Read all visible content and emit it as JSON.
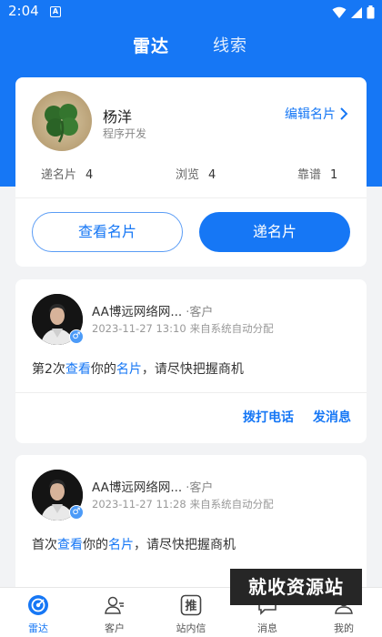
{
  "status_bar": {
    "time": "2:04",
    "a_icon": "A"
  },
  "top_tabs": [
    {
      "label": "雷达",
      "active": true
    },
    {
      "label": "线索",
      "active": false
    }
  ],
  "profile": {
    "name": "杨洋",
    "title": "程序开发",
    "edit_label": "编辑名片",
    "stats": [
      {
        "label": "递名片",
        "value": "4"
      },
      {
        "label": "浏览",
        "value": "4"
      },
      {
        "label": "靠谱",
        "value": "1"
      }
    ],
    "view_card_label": "查看名片",
    "send_card_label": "递名片"
  },
  "messages": [
    {
      "name": "AA博远网络网...",
      "tag": "·客户",
      "time": "2023-11-27 13:10",
      "note": "来自系统自动分配",
      "text": {
        "prefix": "第2次",
        "hl1": "查看",
        "mid": "你的",
        "hl2": "名片",
        "suffix": "，请尽快把握商机"
      },
      "call_label": "拨打电话",
      "msg_label": "发消息"
    },
    {
      "name": "AA博远网络网...",
      "tag": "·客户",
      "time": "2023-11-27 11:28",
      "note": "来自系统自动分配",
      "text": {
        "prefix": "首次",
        "hl1": "查看",
        "mid": "你的",
        "hl2": "名片",
        "suffix": "，请尽快把握商机"
      }
    }
  ],
  "bottom_nav": [
    {
      "label": "雷达",
      "icon": "radar-icon",
      "active": true
    },
    {
      "label": "客户",
      "icon": "customer-icon",
      "active": false
    },
    {
      "label": "站内信",
      "icon": "promote-icon",
      "icon_text": "推",
      "active": false
    },
    {
      "label": "消息",
      "icon": "message-icon",
      "active": false
    },
    {
      "label": "我的",
      "icon": "profile-icon",
      "active": false
    }
  ],
  "watermark": "就收资源站",
  "colors": {
    "primary": "#1677f5",
    "background": "#f2f3f5"
  }
}
